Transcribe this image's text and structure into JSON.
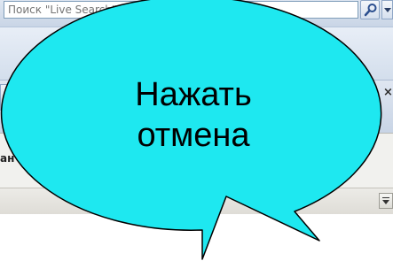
{
  "search": {
    "placeholder": "Поиск \"Live Search\""
  },
  "tab": {
    "close_label": "×"
  },
  "panel": {
    "label_fragment": "ан"
  },
  "callout": {
    "line1": "Нажать",
    "line2": "отмена",
    "fill_color": "#1ee8f0",
    "stroke_color": "#000000"
  },
  "icons": {
    "search": "magnifier-icon",
    "dropdown": "chevron-down-icon",
    "scroll": "scroll-down-icon"
  }
}
